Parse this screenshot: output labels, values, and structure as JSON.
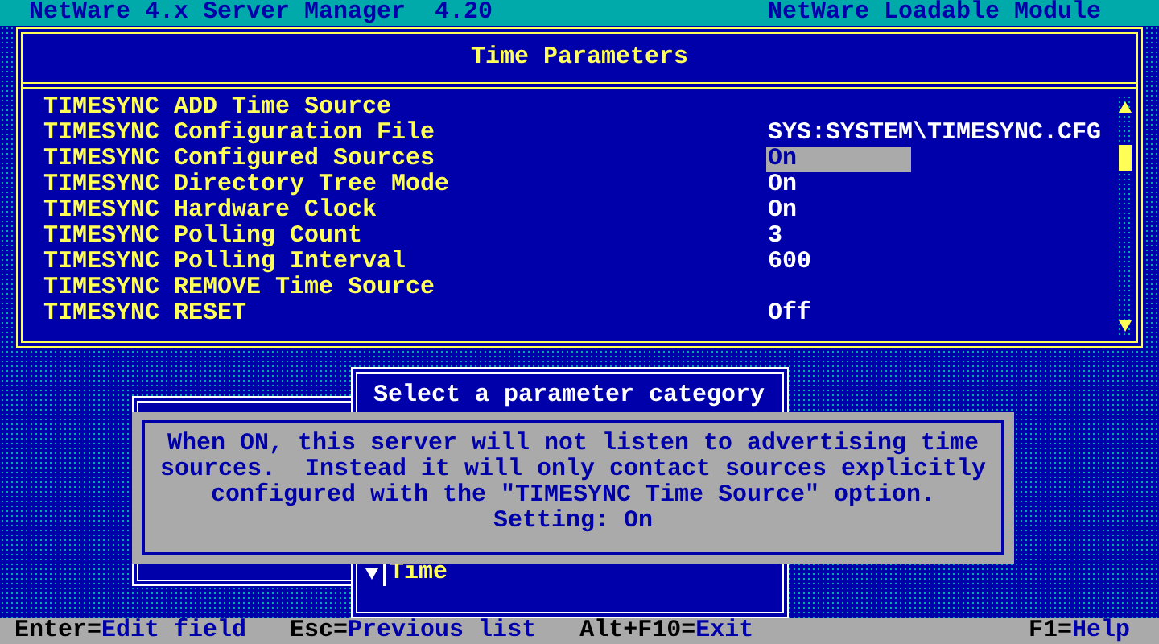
{
  "header": {
    "title": "NetWare 4.x Server Manager  4.20",
    "module": "NetWare Loadable Module"
  },
  "parameters_window": {
    "title": "Time Parameters",
    "rows": [
      {
        "name": "TIMESYNC ADD Time Source",
        "selected": false
      },
      {
        "name": "TIMESYNC Configuration File",
        "value": "SYS:SYSTEM\\TIMESYNC.CFG",
        "selected": false
      },
      {
        "name": "TIMESYNC Configured Sources",
        "value": "On",
        "selected": true
      },
      {
        "name": "TIMESYNC Directory Tree Mode",
        "value": "On",
        "selected": false
      },
      {
        "name": "TIMESYNC Hardware Clock",
        "value": "On",
        "selected": false
      },
      {
        "name": "TIMESYNC Polling Count",
        "value": "3",
        "selected": false
      },
      {
        "name": "TIMESYNC Polling Interval",
        "value": "600",
        "selected": false
      },
      {
        "name": "TIMESYNC REMOVE Time Source",
        "selected": false
      },
      {
        "name": "TIMESYNC RESET",
        "value": "Off",
        "selected": false
      }
    ]
  },
  "category_window": {
    "title": "Select a parameter category",
    "items": [
      {
        "label": "Time",
        "selected": true
      }
    ]
  },
  "help_box": {
    "lines": [
      "When ON, this server will not listen to advertising time",
      "sources.  Instead it will only contact sources explicitly",
      "configured with the \"TIMESYNC Time Source\" option.",
      "Setting: On"
    ]
  },
  "status_bar": [
    {
      "key": "Enter=",
      "action": "Edit field"
    },
    {
      "key": "Esc=",
      "action": "Previous list"
    },
    {
      "key": "Alt+F10=",
      "action": "Exit"
    },
    {
      "key": "F1=",
      "action": "Help"
    }
  ]
}
